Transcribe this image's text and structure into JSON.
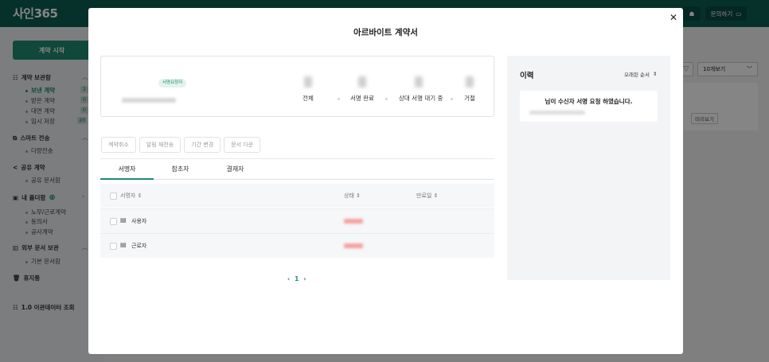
{
  "app": {
    "logo": "사인365",
    "inquiry_label": "문의하기",
    "start_button": "계약 시작"
  },
  "sidebar": {
    "sections": [
      {
        "label": "계약 보관함"
      },
      {
        "label": "스마트 전송"
      },
      {
        "label": "공유 계약"
      },
      {
        "label": "내 폴더함"
      },
      {
        "label": "외부 문서 보관"
      },
      {
        "label": "휴지통"
      },
      {
        "label": "1.0 이관데이터 조회"
      }
    ],
    "items": [
      {
        "label": "보낸 계약",
        "count": "1"
      },
      {
        "label": "받은 계약",
        "count": "0"
      },
      {
        "label": "대면 계약",
        "count": "0"
      },
      {
        "label": "임시 저장",
        "count": "20"
      },
      {
        "label": "다량전송"
      },
      {
        "label": "공유 문서함"
      },
      {
        "label": "노무/근로계약"
      },
      {
        "label": "동의서"
      },
      {
        "label": "공사계약"
      },
      {
        "label": "기본 문서함"
      }
    ]
  },
  "background": {
    "page_size_label": "10개보기",
    "preview_label": "미리보기"
  },
  "modal": {
    "title": "아르바이트 계약서",
    "close_symbol": "✕",
    "badge": "서명요청자",
    "stats": [
      {
        "label": "전체"
      },
      {
        "label": "서명 완료"
      },
      {
        "label": "상대 서명 대기 중"
      },
      {
        "label": "거절"
      }
    ],
    "actions": [
      "계약취소",
      "알림 재전송",
      "기간 변경",
      "문서 다운"
    ],
    "tabs": [
      "서명자",
      "참조자",
      "결재자"
    ],
    "table": {
      "headers": [
        "서명자",
        "상태",
        "만료일"
      ],
      "rows": [
        {
          "name": "사용자"
        },
        {
          "name": "근로자"
        }
      ]
    },
    "pager": {
      "prev": "‹",
      "page": "1",
      "next": "›"
    },
    "history": {
      "title": "이력",
      "sort_label": "오래된 순서",
      "message": "님이 수신자 서명 요청 하였습니다."
    }
  }
}
